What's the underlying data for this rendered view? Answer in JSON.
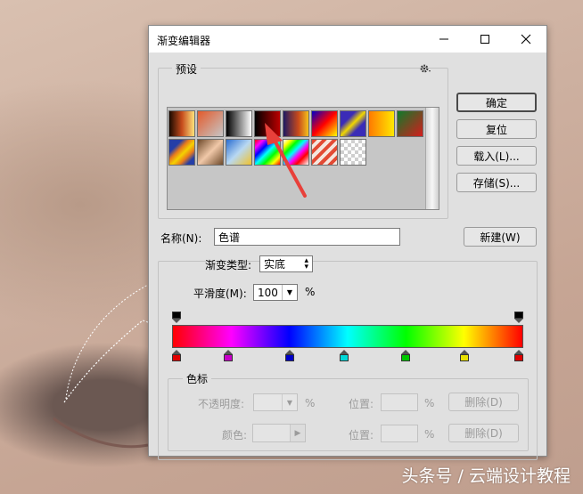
{
  "window": {
    "title": "渐变编辑器",
    "minimize_icon": "minimize-icon",
    "maximize_icon": "maximize-icon",
    "close_icon": "close-icon"
  },
  "presets": {
    "legend": "预设",
    "gear_icon": "gear-icon",
    "swatches": [
      "linear-gradient(90deg,#1a0a00,#c64b1c 50%,#ffe27a)",
      "linear-gradient(135deg,#e35a2b 0%,rgba(227,90,43,0) 100%)",
      "linear-gradient(90deg,#000,#fff)",
      "linear-gradient(90deg,#000,#b00)",
      "linear-gradient(90deg,#1d1a63,#c94a1a 60%,#f3c11c)",
      "linear-gradient(135deg,#0000c8,#ff0000 50%,#ffff00)",
      "linear-gradient(135deg,#3a2cb7 30%,#f1d800 50%,#3a2cb7 70%)",
      "linear-gradient(90deg,#ff7a00,#ffe800)",
      "linear-gradient(135deg,#0e7a2a,#d51c1c)",
      "linear-gradient(135deg,#243ea7 25%,#e87a1d 40%,#f4d200 55%,#e87a1d 70%,#243ea7 85%)",
      "linear-gradient(135deg,#6e4a2b,#f0c8a8 50%,#6e4a2b)",
      "linear-gradient(135deg,#2b6ed1,#b8d8f2 50%,#f1c22b)",
      "linear-gradient(135deg,#ff0000,#ff00ff,#0000ff,#00ffff,#00ff00,#ffff00,#ff0000)",
      "linear-gradient(135deg,#fff 0%,#ff0 15%,#0f0 30%,#0ff 45%,#f0f 60%,#f00 75%,#fff 100%)",
      "repeating-linear-gradient(135deg,#e24a34 0 4px,#f5e6de 4px 8px)",
      "repeating-conic-gradient(#cfcfcf 0 25%,#ffffff 0 50%) 0 0/8px 8px"
    ]
  },
  "buttons": {
    "ok": "确定",
    "reset": "复位",
    "load": "载入(L)...",
    "save": "存储(S)...",
    "new": "新建(W)"
  },
  "name": {
    "label": "名称(N):",
    "value": "色谱"
  },
  "gradient": {
    "type_label": "渐变类型:",
    "type_value": "实底",
    "smoothness_label": "平滑度(M):",
    "smoothness_value": "100",
    "smoothness_unit": "%",
    "color_stops": [
      {
        "color": "#e00000",
        "position_pct": 0
      },
      {
        "color": "#c800c8",
        "position_pct": 15
      },
      {
        "color": "#0000c8",
        "position_pct": 33
      },
      {
        "color": "#00d8d8",
        "position_pct": 49
      },
      {
        "color": "#00c800",
        "position_pct": 67
      },
      {
        "color": "#e8e000",
        "position_pct": 84
      },
      {
        "color": "#e00000",
        "position_pct": 100
      }
    ],
    "opacity_stops": [
      {
        "opacity_pct": 100,
        "position_pct": 0
      },
      {
        "opacity_pct": 100,
        "position_pct": 100
      }
    ]
  },
  "stops_group": {
    "legend": "色标",
    "opacity_label": "不透明度:",
    "opacity_value": "",
    "percent_1": "%",
    "location_label_1": "位置:",
    "location_value_1": "",
    "percent_2": "%",
    "delete_1": "删除(D)",
    "color_label": "颜色:",
    "location_label_2": "位置:",
    "location_value_2": "",
    "percent_3": "%",
    "delete_2": "删除(D)"
  },
  "annotation": {
    "arrow_color": "#e8403a"
  },
  "watermark": "头条号 / 云端设计教程"
}
